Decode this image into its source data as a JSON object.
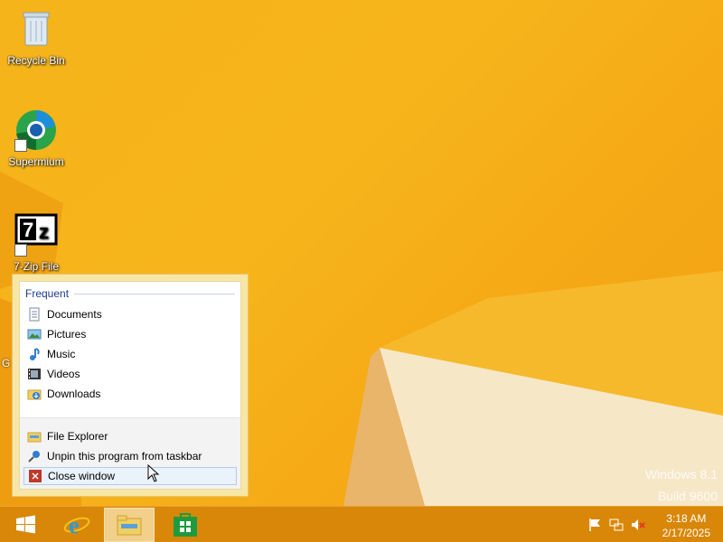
{
  "desktop": {
    "icons": [
      {
        "label": "Recycle Bin",
        "icon": "recycle-bin-icon"
      },
      {
        "label": "Supermium",
        "icon": "supermium-icon"
      },
      {
        "label": "7-Zip File",
        "icon": "7zip-icon"
      }
    ],
    "partial_letter": "G",
    "watermark": {
      "line1": "Windows 8.1",
      "line2": "Build 9600"
    }
  },
  "jumplist": {
    "section_title": "Frequent",
    "frequent_items": [
      {
        "label": "Documents",
        "icon": "documents-icon"
      },
      {
        "label": "Pictures",
        "icon": "pictures-icon"
      },
      {
        "label": "Music",
        "icon": "music-icon"
      },
      {
        "label": "Videos",
        "icon": "videos-icon"
      },
      {
        "label": "Downloads",
        "icon": "downloads-icon"
      }
    ],
    "tasks": [
      {
        "label": "File Explorer",
        "icon": "file-explorer-icon"
      },
      {
        "label": "Unpin this program from taskbar",
        "icon": "unpin-icon"
      },
      {
        "label": "Close window",
        "icon": "close-icon"
      }
    ]
  },
  "taskbar": {
    "buttons": [
      "start-icon",
      "internet-explorer-icon",
      "file-explorer-icon",
      "store-icon"
    ],
    "tray_icons": [
      "flag-icon",
      "network-icon",
      "volume-muted-icon"
    ],
    "clock": {
      "time": "3:18 AM",
      "date": "2/17/2025"
    }
  },
  "colors": {
    "wallpaper": "#f4b41a",
    "taskbar": "#d88708",
    "accent": "#1e3c8c"
  }
}
